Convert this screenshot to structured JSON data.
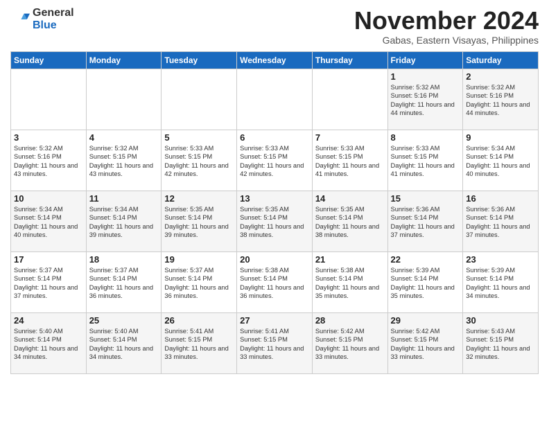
{
  "logo": {
    "general": "General",
    "blue": "Blue"
  },
  "header": {
    "month": "November 2024",
    "location": "Gabas, Eastern Visayas, Philippines"
  },
  "weekdays": [
    "Sunday",
    "Monday",
    "Tuesday",
    "Wednesday",
    "Thursday",
    "Friday",
    "Saturday"
  ],
  "weeks": [
    [
      {
        "day": "",
        "info": ""
      },
      {
        "day": "",
        "info": ""
      },
      {
        "day": "",
        "info": ""
      },
      {
        "day": "",
        "info": ""
      },
      {
        "day": "",
        "info": ""
      },
      {
        "day": "1",
        "info": "Sunrise: 5:32 AM\nSunset: 5:16 PM\nDaylight: 11 hours\nand 44 minutes."
      },
      {
        "day": "2",
        "info": "Sunrise: 5:32 AM\nSunset: 5:16 PM\nDaylight: 11 hours\nand 44 minutes."
      }
    ],
    [
      {
        "day": "3",
        "info": "Sunrise: 5:32 AM\nSunset: 5:16 PM\nDaylight: 11 hours\nand 43 minutes."
      },
      {
        "day": "4",
        "info": "Sunrise: 5:32 AM\nSunset: 5:15 PM\nDaylight: 11 hours\nand 43 minutes."
      },
      {
        "day": "5",
        "info": "Sunrise: 5:33 AM\nSunset: 5:15 PM\nDaylight: 11 hours\nand 42 minutes."
      },
      {
        "day": "6",
        "info": "Sunrise: 5:33 AM\nSunset: 5:15 PM\nDaylight: 11 hours\nand 42 minutes."
      },
      {
        "day": "7",
        "info": "Sunrise: 5:33 AM\nSunset: 5:15 PM\nDaylight: 11 hours\nand 41 minutes."
      },
      {
        "day": "8",
        "info": "Sunrise: 5:33 AM\nSunset: 5:15 PM\nDaylight: 11 hours\nand 41 minutes."
      },
      {
        "day": "9",
        "info": "Sunrise: 5:34 AM\nSunset: 5:14 PM\nDaylight: 11 hours\nand 40 minutes."
      }
    ],
    [
      {
        "day": "10",
        "info": "Sunrise: 5:34 AM\nSunset: 5:14 PM\nDaylight: 11 hours\nand 40 minutes."
      },
      {
        "day": "11",
        "info": "Sunrise: 5:34 AM\nSunset: 5:14 PM\nDaylight: 11 hours\nand 39 minutes."
      },
      {
        "day": "12",
        "info": "Sunrise: 5:35 AM\nSunset: 5:14 PM\nDaylight: 11 hours\nand 39 minutes."
      },
      {
        "day": "13",
        "info": "Sunrise: 5:35 AM\nSunset: 5:14 PM\nDaylight: 11 hours\nand 38 minutes."
      },
      {
        "day": "14",
        "info": "Sunrise: 5:35 AM\nSunset: 5:14 PM\nDaylight: 11 hours\nand 38 minutes."
      },
      {
        "day": "15",
        "info": "Sunrise: 5:36 AM\nSunset: 5:14 PM\nDaylight: 11 hours\nand 37 minutes."
      },
      {
        "day": "16",
        "info": "Sunrise: 5:36 AM\nSunset: 5:14 PM\nDaylight: 11 hours\nand 37 minutes."
      }
    ],
    [
      {
        "day": "17",
        "info": "Sunrise: 5:37 AM\nSunset: 5:14 PM\nDaylight: 11 hours\nand 37 minutes."
      },
      {
        "day": "18",
        "info": "Sunrise: 5:37 AM\nSunset: 5:14 PM\nDaylight: 11 hours\nand 36 minutes."
      },
      {
        "day": "19",
        "info": "Sunrise: 5:37 AM\nSunset: 5:14 PM\nDaylight: 11 hours\nand 36 minutes."
      },
      {
        "day": "20",
        "info": "Sunrise: 5:38 AM\nSunset: 5:14 PM\nDaylight: 11 hours\nand 36 minutes."
      },
      {
        "day": "21",
        "info": "Sunrise: 5:38 AM\nSunset: 5:14 PM\nDaylight: 11 hours\nand 35 minutes."
      },
      {
        "day": "22",
        "info": "Sunrise: 5:39 AM\nSunset: 5:14 PM\nDaylight: 11 hours\nand 35 minutes."
      },
      {
        "day": "23",
        "info": "Sunrise: 5:39 AM\nSunset: 5:14 PM\nDaylight: 11 hours\nand 34 minutes."
      }
    ],
    [
      {
        "day": "24",
        "info": "Sunrise: 5:40 AM\nSunset: 5:14 PM\nDaylight: 11 hours\nand 34 minutes."
      },
      {
        "day": "25",
        "info": "Sunrise: 5:40 AM\nSunset: 5:14 PM\nDaylight: 11 hours\nand 34 minutes."
      },
      {
        "day": "26",
        "info": "Sunrise: 5:41 AM\nSunset: 5:15 PM\nDaylight: 11 hours\nand 33 minutes."
      },
      {
        "day": "27",
        "info": "Sunrise: 5:41 AM\nSunset: 5:15 PM\nDaylight: 11 hours\nand 33 minutes."
      },
      {
        "day": "28",
        "info": "Sunrise: 5:42 AM\nSunset: 5:15 PM\nDaylight: 11 hours\nand 33 minutes."
      },
      {
        "day": "29",
        "info": "Sunrise: 5:42 AM\nSunset: 5:15 PM\nDaylight: 11 hours\nand 33 minutes."
      },
      {
        "day": "30",
        "info": "Sunrise: 5:43 AM\nSunset: 5:15 PM\nDaylight: 11 hours\nand 32 minutes."
      }
    ]
  ]
}
